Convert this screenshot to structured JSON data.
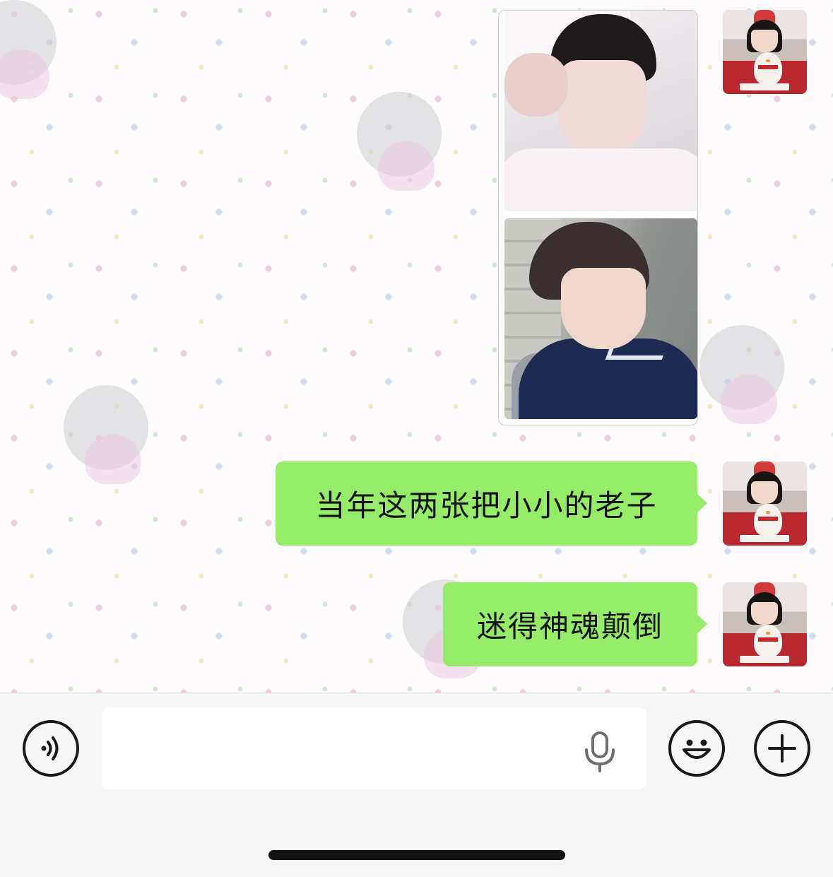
{
  "chat": {
    "messages": [
      {
        "type": "image-group",
        "sender": "self",
        "images": [
          "photo-1",
          "photo-2"
        ]
      },
      {
        "type": "text",
        "sender": "self",
        "text": "当年这两张把小小的老子"
      },
      {
        "type": "text",
        "sender": "self",
        "text": "迷得神魂颠倒"
      }
    ],
    "bubble_color": "#95ec69"
  },
  "input_bar": {
    "text_value": "",
    "voice_icon": "voice-icon",
    "mic_icon": "microphone-icon",
    "emoji_icon": "smiley-icon",
    "plus_icon": "plus-icon"
  }
}
